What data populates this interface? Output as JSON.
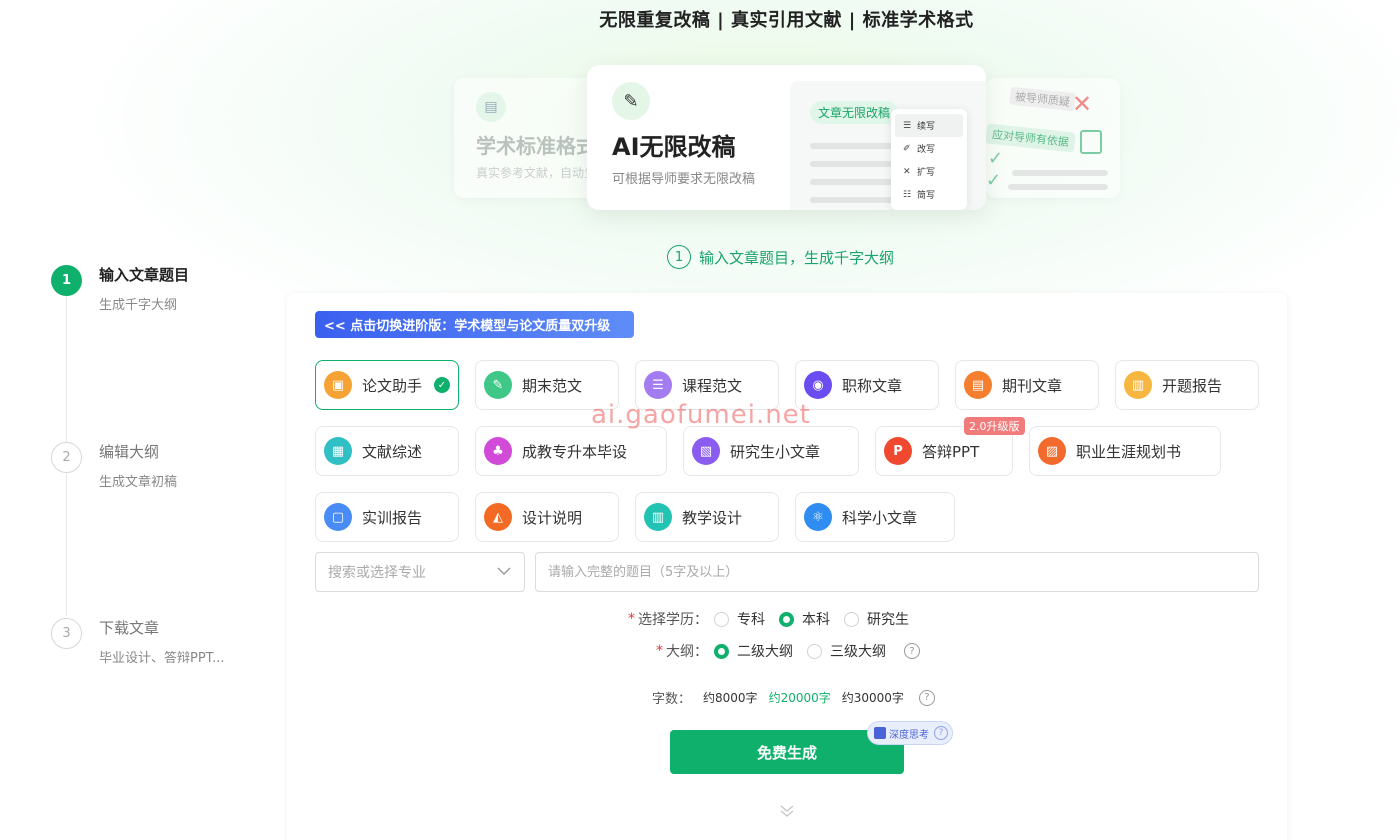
{
  "headline": "无限重复改稿 | 真实引用文献 | 标准学术格式",
  "hero": {
    "left": {
      "title": "学术标准格式",
      "subtitle": "真实参考文献，自动生"
    },
    "main": {
      "title": "AI无限改稿",
      "subtitle": "可根据导师要求无限改稿",
      "tag": "文章无限改稿",
      "menu": [
        "续写",
        "改写",
        "扩写",
        "简写"
      ]
    },
    "right": {
      "tag1": "被导师质疑",
      "tag2": "应对导师有依据"
    }
  },
  "section_heading": {
    "number": "1",
    "text": "输入文章题目，生成千字大纲"
  },
  "steps": [
    {
      "number": "1",
      "title": "输入文章题目",
      "subtitle": "生成千字大纲",
      "active": true
    },
    {
      "number": "2",
      "title": "编辑大纲",
      "subtitle": "生成文章初稿",
      "active": false
    },
    {
      "number": "3",
      "title": "下载文章",
      "subtitle": "毕业设计、答辩PPT...",
      "active": false
    }
  ],
  "banner": "<< 点击切换进阶版：学术模型与论文质量双升级",
  "categories": [
    {
      "label": "论文助手",
      "color": "#f7a234",
      "glyph": "▣",
      "selected": true
    },
    {
      "label": "期末范文",
      "color": "#3fc788",
      "glyph": "✎"
    },
    {
      "label": "课程范文",
      "color": "#a27cf0",
      "glyph": "☰"
    },
    {
      "label": "职称文章",
      "color": "#6a4cf0",
      "glyph": "◉"
    },
    {
      "label": "期刊文章",
      "color": "#f57f2e",
      "glyph": "▤"
    },
    {
      "label": "开题报告",
      "color": "#f7b640",
      "glyph": "▥"
    },
    {
      "label": "文献综述",
      "color": "#2fbfc4",
      "glyph": "▦"
    },
    {
      "label": "成教专升本毕设",
      "color": "#d14ad8",
      "glyph": "♣"
    },
    {
      "label": "研究生小文章",
      "color": "#8a5cf0",
      "glyph": "▧"
    },
    {
      "label": "答辩PPT",
      "color": "#f0492f",
      "glyph": "P",
      "badge": "2.0升级版"
    },
    {
      "label": "职业生涯规划书",
      "color": "#f26a2c",
      "glyph": "▨"
    },
    {
      "label": "实训报告",
      "color": "#4a8cf5",
      "glyph": "▢"
    },
    {
      "label": "设计说明",
      "color": "#f36a24",
      "glyph": "◭"
    },
    {
      "label": "教学设计",
      "color": "#22c3b3",
      "glyph": "▥"
    },
    {
      "label": "科学小文章",
      "color": "#2f8cf0",
      "glyph": "⚛"
    }
  ],
  "watermark": "ai.gaofumei.net",
  "form": {
    "major_placeholder": "搜索或选择专业",
    "topic_placeholder": "请输入完整的题目（5字及以上）",
    "education_label": "选择学历：",
    "education_options": [
      "专科",
      "本科",
      "研究生"
    ],
    "education_selected": 1,
    "outline_label": "大纲：",
    "outline_options": [
      "二级大纲",
      "三级大纲"
    ],
    "outline_selected": 0,
    "words_label": "字数：",
    "words_options": [
      "约8000字",
      "约20000字",
      "约30000字"
    ],
    "words_selected": 1,
    "generate_label": "免费生成",
    "deep_label": "深度思考"
  },
  "colors": {
    "accent": "#0fb06b",
    "banner": "#3a5ff0",
    "badge": "#f17b7b"
  }
}
